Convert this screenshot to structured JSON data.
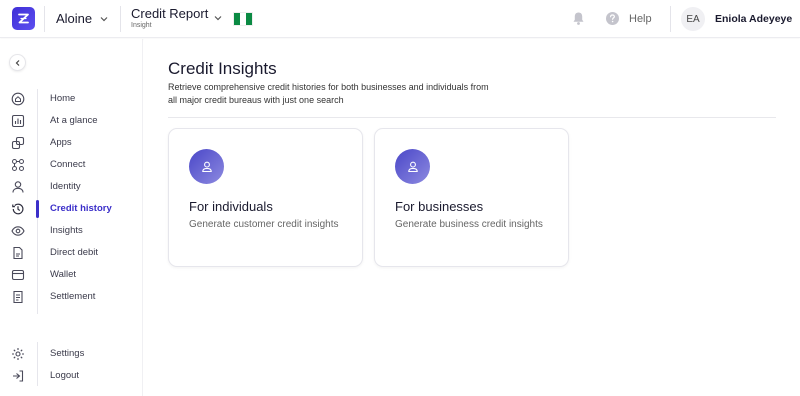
{
  "header": {
    "workspace_name": "Aloine",
    "product_title": "Credit Report",
    "product_subtitle": "Insight",
    "help_label": "Help",
    "user_initials": "EA",
    "user_name": "Eniola Adeyeye"
  },
  "sidebar": {
    "items": [
      {
        "label": "Home",
        "icon": "home-icon"
      },
      {
        "label": "At a glance",
        "icon": "bar-chart-icon"
      },
      {
        "label": "Apps",
        "icon": "apps-icon"
      },
      {
        "label": "Connect",
        "icon": "connect-icon"
      },
      {
        "label": "Identity",
        "icon": "user-icon"
      },
      {
        "label": "Credit history",
        "icon": "history-icon",
        "active": true
      },
      {
        "label": "Insights",
        "icon": "eye-icon"
      },
      {
        "label": "Direct debit",
        "icon": "document-icon"
      },
      {
        "label": "Wallet",
        "icon": "wallet-icon"
      },
      {
        "label": "Settlement",
        "icon": "settlement-icon"
      }
    ],
    "bottom_items": [
      {
        "label": "Settings",
        "icon": "gear-icon"
      },
      {
        "label": "Logout",
        "icon": "logout-icon"
      }
    ]
  },
  "main": {
    "title": "Credit Insights",
    "description": "Retrieve comprehensive credit histories for both businesses and individuals from all major credit bureaus with just one search",
    "cards": [
      {
        "title": "For individuals",
        "description": "Generate customer credit insights"
      },
      {
        "title": "For businesses",
        "description": "Generate business credit insights"
      }
    ]
  },
  "colors": {
    "accent": "#3b2fc9",
    "flag_green": "#0b8a43",
    "flag_white": "#ffffff"
  }
}
